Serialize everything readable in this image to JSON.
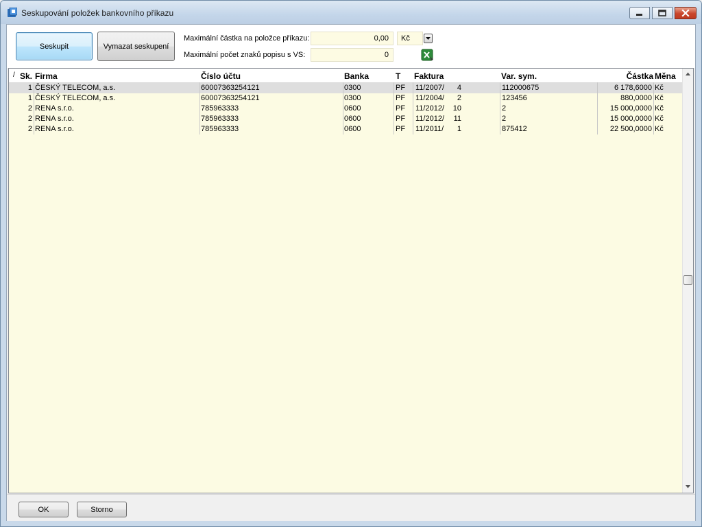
{
  "window": {
    "title": "Seskupování položek bankovního příkazu"
  },
  "toolbar": {
    "group_label": "Seskupit",
    "clear_label": "Vymazat seskupení",
    "max_amount_label": "Maximální částka na položce příkazu:",
    "max_amount_value": "0,00",
    "currency_value": "Kč",
    "max_chars_label": "Maximální počet znaků popisu s VS:",
    "max_chars_value": "0"
  },
  "table": {
    "sort_indicator": "/",
    "columns": {
      "sk": "Sk.",
      "firma": "Firma",
      "ucet": "Číslo účtu",
      "banka": "Banka",
      "t": "T",
      "faktura": "Faktura",
      "vs": "Var. sym.",
      "castka": "Částka",
      "mena": "Měna"
    },
    "rows": [
      {
        "sk": "1",
        "firma": "ČESKÝ TELECOM, a.s.",
        "ucet": "60007363254121",
        "banka": "0300",
        "t": "PF",
        "faktura_period": "11/2007/",
        "faktura_no": "4",
        "vs": "112000675",
        "castka": "6 178,6000",
        "mena": "Kč"
      },
      {
        "sk": "1",
        "firma": "ČESKÝ TELECOM, a.s.",
        "ucet": "60007363254121",
        "banka": "0300",
        "t": "PF",
        "faktura_period": "11/2004/",
        "faktura_no": "2",
        "vs": "123456",
        "castka": "880,0000",
        "mena": "Kč"
      },
      {
        "sk": "2",
        "firma": "RENA s.r.o.",
        "ucet": "785963333",
        "banka": "0600",
        "t": "PF",
        "faktura_period": "11/2012/",
        "faktura_no": "10",
        "vs": "2",
        "castka": "15 000,0000",
        "mena": "Kč"
      },
      {
        "sk": "2",
        "firma": "RENA s.r.o.",
        "ucet": "785963333",
        "banka": "0600",
        "t": "PF",
        "faktura_period": "11/2012/",
        "faktura_no": "11",
        "vs": "2",
        "castka": "15 000,0000",
        "mena": "Kč"
      },
      {
        "sk": "2",
        "firma": "RENA s.r.o.",
        "ucet": "785963333",
        "banka": "0600",
        "t": "PF",
        "faktura_period": "11/2011/",
        "faktura_no": "1",
        "vs": "875412",
        "castka": "22 500,0000",
        "mena": "Kč"
      }
    ]
  },
  "footer": {
    "ok_label": "OK",
    "cancel_label": "Storno"
  },
  "colors": {
    "grid_background": "#fcfbe3",
    "selected_row": "#dedede",
    "primary_button_border": "#3c7fb1"
  }
}
